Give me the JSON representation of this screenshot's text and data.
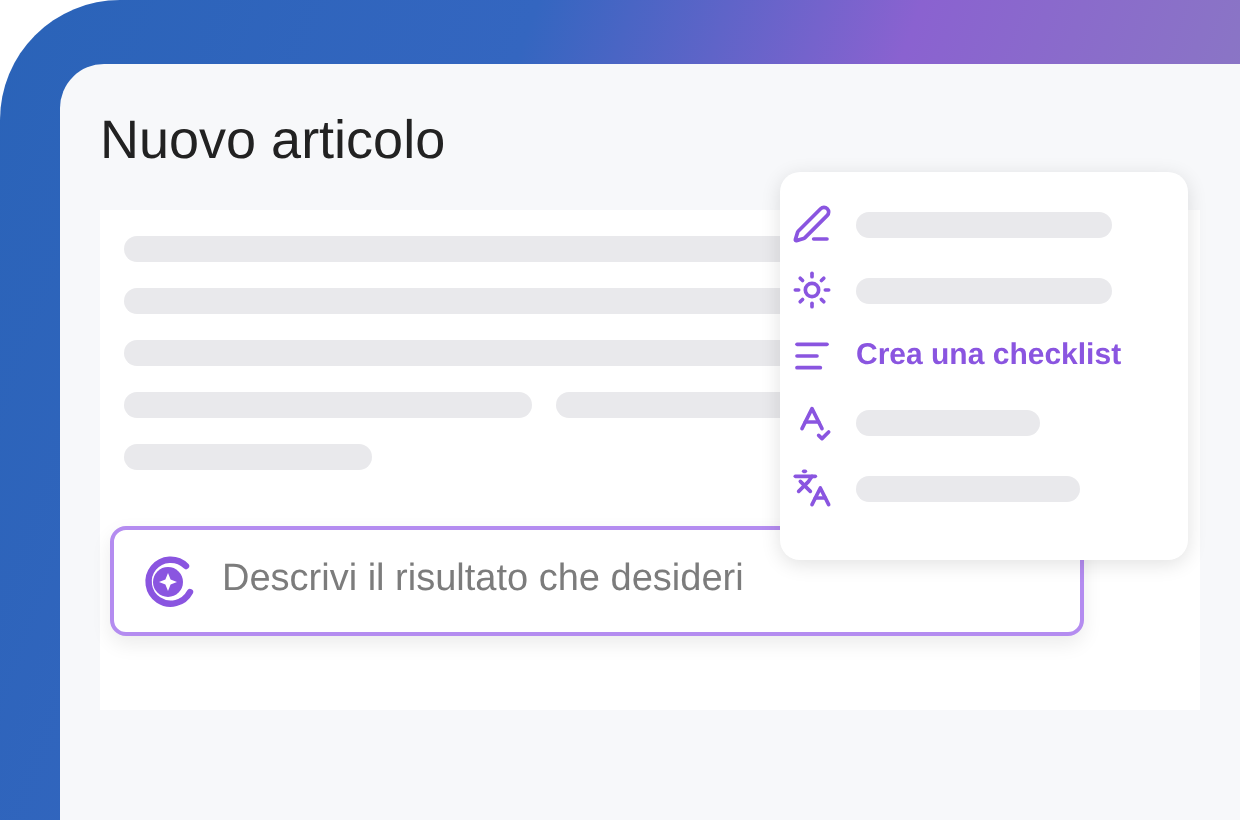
{
  "title": "Nuovo articolo",
  "menu": {
    "items": [
      {
        "kind": "placeholder"
      },
      {
        "kind": "placeholder"
      },
      {
        "kind": "action",
        "label": "Crea una checklist"
      },
      {
        "kind": "placeholder"
      },
      {
        "kind": "placeholder"
      }
    ]
  },
  "prompt": {
    "placeholder": "Descrivi il risultato che desideri"
  }
}
